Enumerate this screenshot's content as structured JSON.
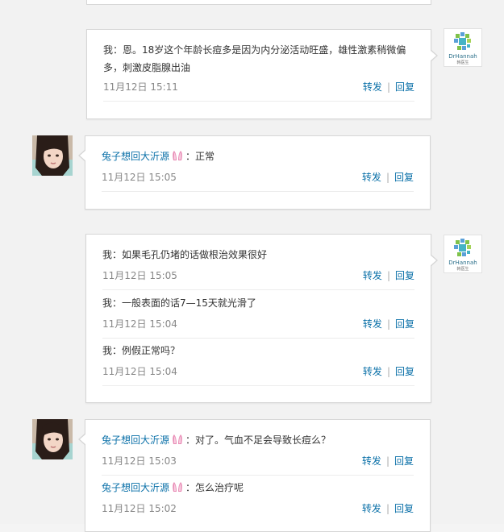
{
  "messages": {
    "m1": {
      "text": "我：恩。18岁这个年龄长痘多是因为内分泌活动旺盛，雄性激素稍微偏多，刺激皮脂腺出油",
      "time": "11月12日 15:11"
    },
    "m2": {
      "name": "兔子想回大沂源",
      "text": "：正常",
      "time": "11月12日 15:05"
    },
    "m3": {
      "text": "我：如果毛孔仍堵的话做根治效果很好",
      "time": "11月12日 15:05"
    },
    "m4": {
      "text": "我：一般表面的话7—15天就光滑了",
      "time": "11月12日 15:04"
    },
    "m5": {
      "text": "我：例假正常吗？",
      "time": "11月12日 15:04"
    },
    "m6": {
      "name": "兔子想回大沂源",
      "text": "：对了。气血不足会导致长痘么？",
      "time": "11月12日 15:03"
    },
    "m7": {
      "name": "兔子想回大沂源",
      "text": "：怎么治疗呢",
      "time": "11月12日 15:02"
    }
  },
  "actions": {
    "forward": "转发",
    "reply": "回复",
    "sep": "|"
  },
  "doctor_avatar": {
    "brand": "DrHannah",
    "sub": "韩医生"
  },
  "colors": {
    "link": "#0a70a8",
    "time": "#888888",
    "text": "#333333"
  }
}
